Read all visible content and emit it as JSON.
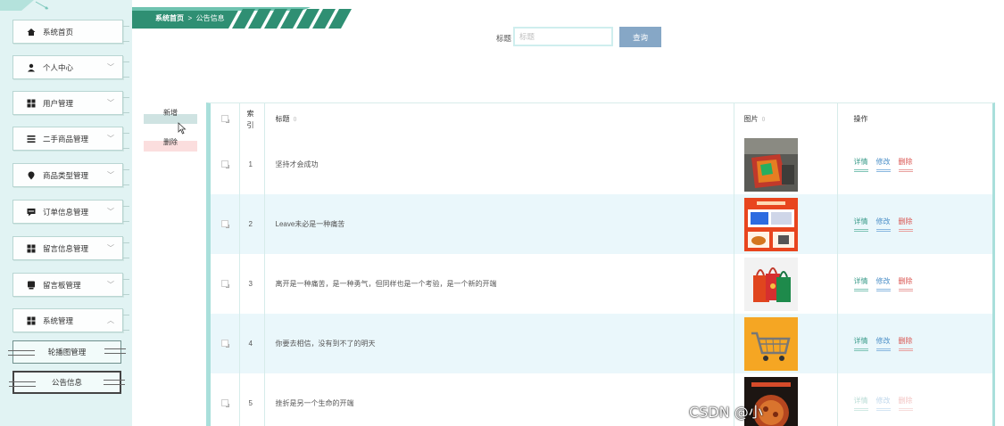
{
  "sidebar": {
    "items": [
      {
        "label": "系统首页",
        "icon": "home-icon",
        "expandable": false
      },
      {
        "label": "个人中心",
        "icon": "user-icon",
        "expandable": true
      },
      {
        "label": "用户管理",
        "icon": "grid-icon",
        "expandable": true
      },
      {
        "label": "二手商品管理",
        "icon": "list-icon",
        "expandable": true
      },
      {
        "label": "商品类型管理",
        "icon": "location-pin-icon",
        "expandable": true
      },
      {
        "label": "订单信息管理",
        "icon": "message-icon",
        "expandable": true
      },
      {
        "label": "留言信息管理",
        "icon": "grid-icon",
        "expandable": true
      },
      {
        "label": "留言板管理",
        "icon": "chat-icon",
        "expandable": true
      },
      {
        "label": "系统管理",
        "icon": "grid-icon",
        "expandable": true,
        "expanded": true
      }
    ],
    "sub_items": [
      {
        "label": "轮播图管理",
        "active": false
      },
      {
        "label": "公告信息",
        "active": true
      }
    ]
  },
  "breadcrumb": {
    "home": "系统首页",
    "separator": ">",
    "current": "公告信息"
  },
  "search": {
    "label": "标题",
    "placeholder": "标题",
    "button": "查询"
  },
  "actions": {
    "add": "新增",
    "delete": "删除"
  },
  "table": {
    "headers": {
      "index": "索引",
      "title": "标题",
      "image": "图片",
      "operation": "操作"
    },
    "rows": [
      {
        "index": "1",
        "title": "坚持才会成功",
        "image": "shopping-bag-photo"
      },
      {
        "index": "2",
        "title": "Leave未必是一种痛苦",
        "image": "app-promo-banner"
      },
      {
        "index": "3",
        "title": "离开是一种痛苦，是一种勇气，但同样也是一个考验，是一个新的开端",
        "image": "tote-bags-photo"
      },
      {
        "index": "4",
        "title": "你要去相信，没有到不了的明天",
        "image": "shopping-cart-photo"
      },
      {
        "index": "5",
        "title": "挫折是另一个生命的开端",
        "image": "food-promo-photo"
      }
    ],
    "row_actions": {
      "detail": "详情",
      "edit": "修改",
      "delete": "删除"
    }
  },
  "watermark": "CSDN @小",
  "colors": {
    "sidebar_bg": "#e1f3f3",
    "accent_teal": "#3a9b8a",
    "search_button": "#86a7c6",
    "row_alt": "#eaf7fb"
  }
}
